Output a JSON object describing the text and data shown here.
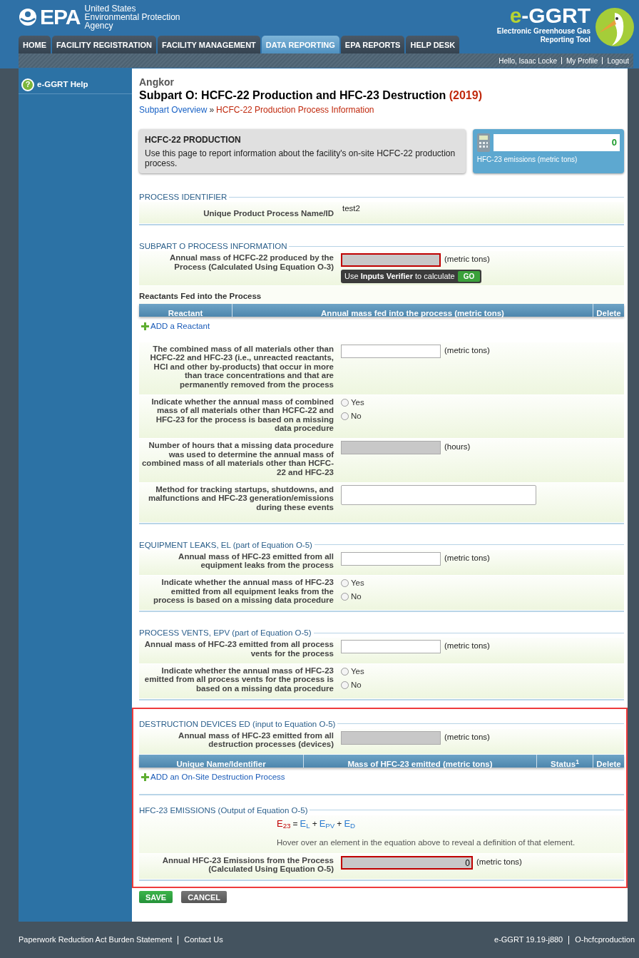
{
  "header": {
    "agency_mark": "EPA",
    "agency_name": [
      "United States",
      "Environmental Protection",
      "Agency"
    ],
    "tool_prefix": "e",
    "tool_name": "-GGRT",
    "tool_full": [
      "Electronic Greenhouse Gas",
      "Reporting Tool"
    ]
  },
  "tabs": [
    {
      "label": "HOME",
      "selected": false
    },
    {
      "label": "FACILITY REGISTRATION",
      "selected": false
    },
    {
      "label": "FACILITY MANAGEMENT",
      "selected": false
    },
    {
      "label": "DATA REPORTING",
      "selected": true
    },
    {
      "label": "EPA REPORTS",
      "selected": false
    },
    {
      "label": "HELP DESK",
      "selected": false
    }
  ],
  "user_links": [
    "Hello, Isaac Locke",
    "My Profile",
    "Logout"
  ],
  "sidebar": {
    "items": [
      {
        "label": "e-GGRT Help",
        "icon": "?"
      }
    ]
  },
  "facility": "Angkor",
  "title": "Subpart O: HCFC-22 Production and HFC-23 Destruction",
  "year": "(2019)",
  "breadcrumb": {
    "link": "Subpart Overview",
    "separator": "»",
    "current": "HCFC-22 Production Process Information"
  },
  "intro": {
    "heading": "HCFC-22 PRODUCTION",
    "text": "Use this page to report information about the facility's on-site HCFC-22 production process."
  },
  "calculator": {
    "value": "0",
    "label": "HFC-23 emissions (metric tons)"
  },
  "sections": [
    {
      "title": "PROCESS IDENTIFIER",
      "highlighted": false,
      "items": [
        {
          "kind": "text",
          "label": "Unique Product Process Name/ID",
          "value": "test2"
        }
      ]
    },
    {
      "title": "SUBPART O PROCESS INFORMATION",
      "highlighted": false,
      "items": [
        {
          "kind": "input",
          "label": "Annual mass of HCFC-22 produced by the Process (Calculated Using Equation O-3)",
          "unit": "(metric tons)",
          "disabled": true,
          "error": true,
          "verifier": {
            "text": "Use **Inputs Verifier** to calculate",
            "button": "GO"
          }
        },
        {
          "kind": "subheading",
          "label": "Reactants Fed into the Process"
        },
        {
          "kind": "table",
          "columns": [
            "Reactant",
            "Annual mass fed into the process (metric tons)",
            "Delete"
          ],
          "add_link": "ADD a Reactant"
        },
        {
          "kind": "input",
          "label": "The combined mass of all materials other than HCFC-22 and HFC-23 (i.e., unreacted reactants, HCl and other by-products) that occur in more than trace concentrations and that are permanently removed from the process",
          "unit": "(metric tons)",
          "disabled": false,
          "error": false
        },
        {
          "kind": "radio",
          "label": "Indicate whether the annual mass of combined mass of all materials other than HCFC-22 and HFC-23 for the process is based on a missing data procedure",
          "options": [
            {
              "label": "Yes",
              "selected": false
            },
            {
              "label": "No",
              "selected": false
            }
          ]
        },
        {
          "kind": "input",
          "label": "Number of hours that a missing data procedure was used to determine the annual mass of combined mass of all materials other than HCFC-22 and HFC-23",
          "unit": "(hours)",
          "disabled": true,
          "error": false
        },
        {
          "kind": "textarea",
          "label": "Method for tracking startups, shutdowns, and malfunctions and HFC-23 generation/emissions during these events"
        }
      ]
    },
    {
      "title": "EQUIPMENT LEAKS, EL (part of Equation O-5)",
      "highlighted": false,
      "items": [
        {
          "kind": "input",
          "label": "Annual mass of HFC-23 emitted from all equipment leaks from the process",
          "unit": "(metric tons)",
          "disabled": false,
          "error": false
        },
        {
          "kind": "radio",
          "label": "Indicate whether the annual mass of HFC-23 emitted from all equipment leaks from the process is based on a missing data procedure",
          "options": [
            {
              "label": "Yes",
              "selected": false
            },
            {
              "label": "No",
              "selected": false
            }
          ]
        }
      ]
    },
    {
      "title": "PROCESS VENTS, EPV (part of Equation O-5)",
      "highlighted": false,
      "items": [
        {
          "kind": "input",
          "label": "Annual mass of HFC-23 emitted from all process vents for the process",
          "unit": "(metric tons)",
          "disabled": false,
          "error": false
        },
        {
          "kind": "radio",
          "label": "Indicate whether the annual mass of HFC-23 emitted from all process vents for the process is based on a missing data procedure",
          "options": [
            {
              "label": "Yes",
              "selected": false
            },
            {
              "label": "No",
              "selected": false
            }
          ]
        }
      ]
    },
    {
      "title": "DESTRUCTION DEVICES ED (input to Equation O-5)",
      "highlighted": true,
      "items": [
        {
          "kind": "input",
          "label": "Annual mass of HFC-23 emitted from all destruction processes (devices)",
          "unit": "(metric tons)",
          "disabled": true,
          "error": false
        },
        {
          "kind": "table",
          "columns": [
            "Unique Name/Identifier",
            "Mass of HFC-23 emitted (metric tons)",
            "Status$^{1}$",
            "Delete"
          ],
          "add_link": "ADD an On-Site Destruction Process"
        }
      ]
    },
    {
      "title": "HFC-23 EMISSIONS (Output of Equation O-5)",
      "highlighted": true,
      "items": [
        {
          "kind": "equation",
          "result": "E$_{23}$",
          "operators": [
            "=",
            "+",
            "+"
          ],
          "terms": [
            "E$_{L}$",
            "E$_{PV}$",
            "E$_{D}$"
          ],
          "note": "Hover over an element in the equation above to reveal a definition of that element."
        },
        {
          "kind": "input",
          "label": "Annual HFC-23 Emissions from the Process (Calculated Using Equation O-5)",
          "unit": "(metric tons)",
          "value": "0",
          "disabled": true,
          "error": true
        }
      ]
    }
  ],
  "buttons": [
    {
      "label": "SAVE",
      "kind": "primary"
    },
    {
      "label": "CANCEL",
      "kind": "secondary"
    }
  ],
  "footer": {
    "left": [
      "Paperwork Reduction Act Burden Statement",
      "Contact Us"
    ],
    "right": [
      "e-GGRT 19.19-j880",
      "O-hcfcproduction"
    ]
  }
}
